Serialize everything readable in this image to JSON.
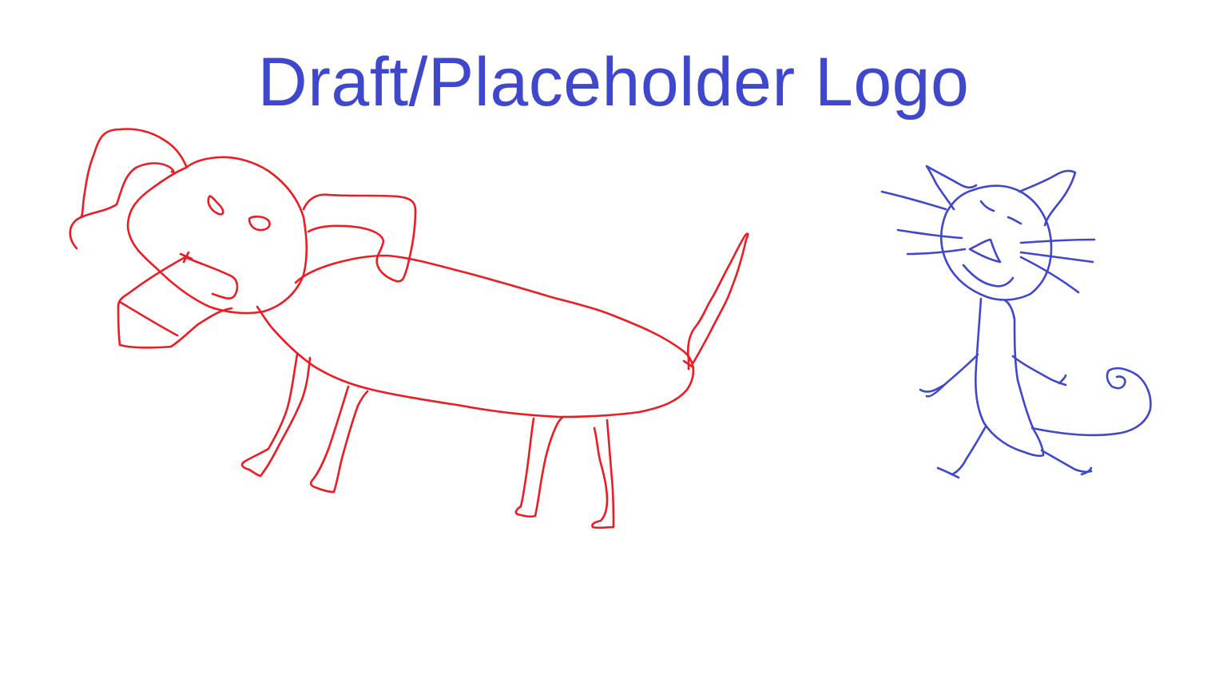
{
  "title": {
    "text": "Draft/Placeholder Logo"
  },
  "colors": {
    "background": "#ffffff",
    "title": "#3f48cc",
    "dog": "#ed1c24",
    "cat": "#3f48cc"
  },
  "figures": {
    "dog": "dog-doodle",
    "cat": "cat-doodle"
  }
}
